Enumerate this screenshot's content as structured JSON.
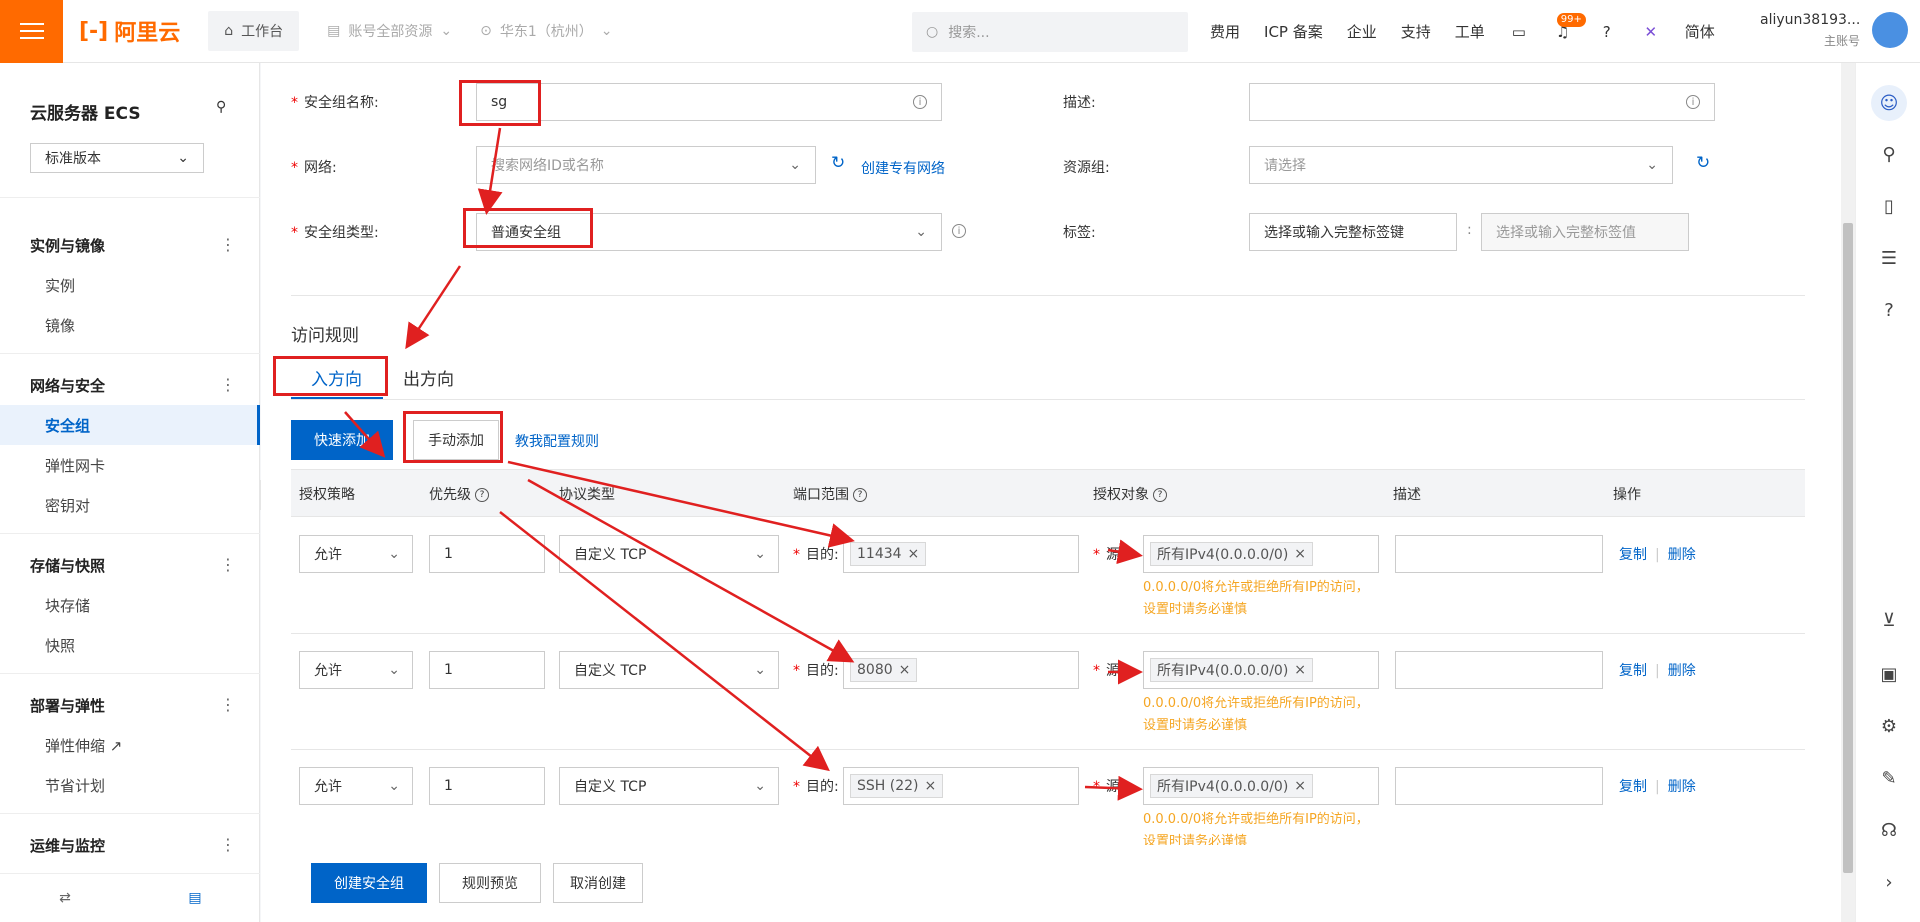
{
  "topbar": {
    "brand": "阿里云",
    "workbench": "工作台",
    "scope": "账号全部资源",
    "region": "华东1（杭州）",
    "search_placeholder": "搜索...",
    "links": [
      "费用",
      "ICP 备案",
      "企业",
      "支持",
      "工单"
    ],
    "notification_badge": "99+",
    "language": "简体",
    "account_name": "aliyun38193...",
    "account_role": "主账号"
  },
  "sidebar": {
    "title": "云服务器 ECS",
    "edition": "标准版本",
    "groups": [
      {
        "label": "实例与镜像",
        "items": [
          "实例",
          "镜像"
        ]
      },
      {
        "label": "网络与安全",
        "items": [
          "安全组",
          "弹性网卡",
          "密钥对"
        ]
      },
      {
        "label": "存储与快照",
        "items": [
          "块存储",
          "快照"
        ]
      },
      {
        "label": "部署与弹性",
        "items": [
          "弹性伸缩",
          "节省计划"
        ]
      },
      {
        "label": "运维与监控",
        "items": []
      }
    ],
    "active_item": "安全组"
  },
  "form": {
    "name_label": "安全组名称:",
    "name_value": "sg",
    "desc_label": "描述:",
    "network_label": "网络:",
    "network_placeholder": "搜索网络ID或名称",
    "create_vpc_link": "创建专有网络",
    "resource_group_label": "资源组:",
    "resource_group_placeholder": "请选择",
    "type_label": "安全组类型:",
    "type_value": "普通安全组",
    "tags_label": "标签:",
    "tag_key_placeholder": "选择或输入完整标签键",
    "tag_value_placeholder": "选择或输入完整标签值",
    "tag_colon": ":"
  },
  "rules": {
    "section_title": "访问规则",
    "tabs": [
      "入方向",
      "出方向"
    ],
    "quick_add": "快速添加",
    "manual_add": "手动添加",
    "guide_link": "教我配置规则",
    "headers": [
      "授权策略",
      "优先级",
      "协议类型",
      "端口范围",
      "授权对象",
      "描述",
      "操作"
    ],
    "dest_prefix": "目的:",
    "src_prefix": "源:",
    "warning": "0.0.0.0/0将允许或拒绝所有IP的访问，设置时请务必谨慎",
    "copy": "复制",
    "delete": "删除",
    "rows": [
      {
        "policy": "允许",
        "priority": "1",
        "protocol": "自定义 TCP",
        "port": "11434",
        "source": "所有IPv4(0.0.0.0/0)"
      },
      {
        "policy": "允许",
        "priority": "1",
        "protocol": "自定义 TCP",
        "port": "8080",
        "source": "所有IPv4(0.0.0.0/0)"
      },
      {
        "policy": "允许",
        "priority": "1",
        "protocol": "自定义 TCP",
        "port": "SSH (22)",
        "source": "所有IPv4(0.0.0.0/0)"
      }
    ]
  },
  "footer": {
    "create": "创建安全组",
    "preview": "规则预览",
    "cancel": "取消创建"
  },
  "colors": {
    "brand": "#ff6a00",
    "primary": "#0064c8",
    "annotation": "#e02020",
    "warning": "#f5a623"
  }
}
